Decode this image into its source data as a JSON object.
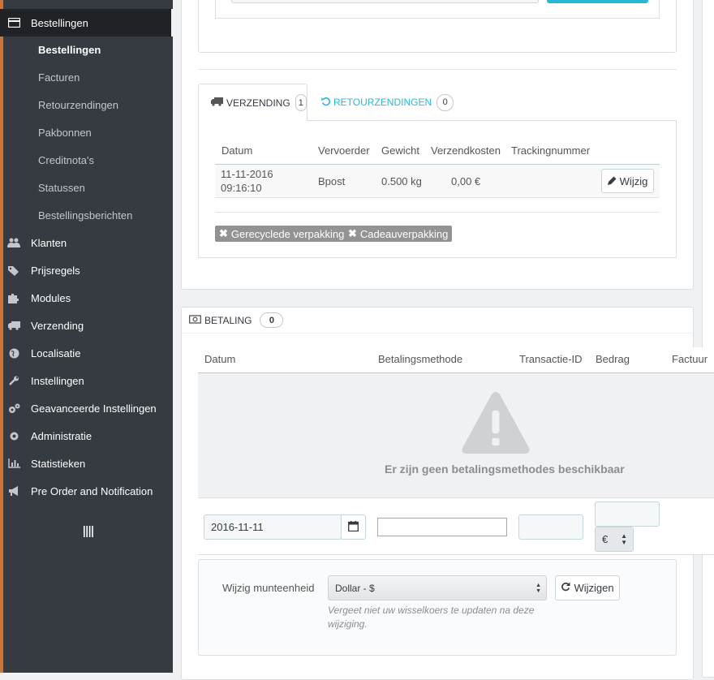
{
  "sidebar": {
    "active_section": "Bestellingen",
    "sub_items": [
      "Bestellingen",
      "Facturen",
      "Retourzendingen",
      "Pakbonnen",
      "Creditnota's",
      "Statussen",
      "Bestellingsberichten"
    ],
    "sections": [
      {
        "label": "Klanten",
        "icon": "users-icon"
      },
      {
        "label": "Prijsregels",
        "icon": "tags-icon"
      },
      {
        "label": "Modules",
        "icon": "puzzle-icon"
      },
      {
        "label": "Verzending",
        "icon": "truck-icon"
      },
      {
        "label": "Localisatie",
        "icon": "globe-icon"
      },
      {
        "label": "Instellingen",
        "icon": "wrench-icon"
      },
      {
        "label": "Geavanceerde Instellingen",
        "icon": "cogs-icon"
      },
      {
        "label": "Administratie",
        "icon": "gear-icon"
      },
      {
        "label": "Statistieken",
        "icon": "bar-chart-icon"
      },
      {
        "label": "Pre Order and Notification",
        "icon": "bullhorn-icon"
      }
    ]
  },
  "shipping": {
    "tabs": [
      {
        "label": "VERZENDING",
        "count": "1"
      },
      {
        "label": "RETOURZENDINGEN",
        "count": "0"
      }
    ],
    "columns": [
      "Datum",
      "Vervoerder",
      "Gewicht",
      "Verzendkosten",
      "Trackingnummer"
    ],
    "row": {
      "date_line1": "11-11-2016",
      "date_line2": "09:16:10",
      "carrier": "Bpost",
      "weight": "0.500 kg",
      "cost": "0,00 €",
      "tracking": ""
    },
    "edit_label": "Wijzig",
    "tags": [
      "Gerecyclede verpakking",
      "Cadeauverpakking"
    ]
  },
  "payment": {
    "title": "BETALING",
    "count": "0",
    "columns": [
      "Datum",
      "Betalingsmethode",
      "Transactie-ID",
      "Bedrag",
      "Factuur"
    ],
    "empty_message": "Er zijn geen betalingsmethodes beschikbaar",
    "form": {
      "date": "2016-11-11",
      "method": "",
      "transaction_id": "",
      "amount": "",
      "currency": "€"
    },
    "currency_change": {
      "label": "Wijzig munteenheid",
      "selected": "Dollar - $",
      "button": "Wijzigen",
      "help": "Vergeet niet uw wisselkoers te updaten na deze wijziging."
    }
  },
  "colors": {
    "sidebar": "#363a41",
    "accent": "#25b9d7",
    "orange_edge": "#c8753e"
  }
}
